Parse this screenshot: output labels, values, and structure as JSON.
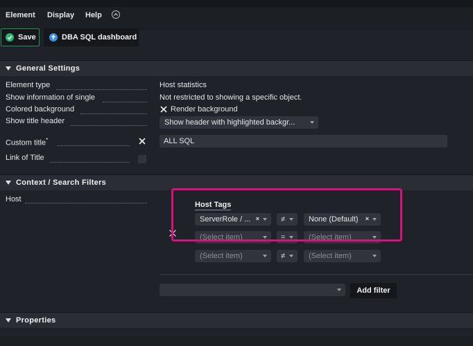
{
  "menu": {
    "items": [
      "Element",
      "Display",
      "Help"
    ]
  },
  "toolbar": {
    "save_label": "Save",
    "dashboard_label": "DBA SQL dashboard"
  },
  "general": {
    "title": "General Settings",
    "rows": {
      "element_type": {
        "label": "Element type",
        "value": "Host statistics"
      },
      "show_info": {
        "label": "Show information of single",
        "value": "Not restricted to showing a specific object."
      },
      "colored_bg": {
        "label": "Colored background",
        "value": "Render background"
      },
      "title_header": {
        "label": "Show title header",
        "value": "Show header with highlighted backgr..."
      },
      "custom_title": {
        "label": "Custom title",
        "required_mark": "*",
        "value": "ALL SQL"
      },
      "link_title": {
        "label": "Link of Title"
      }
    }
  },
  "context": {
    "title": "Context / Search Filters",
    "host_label": "Host",
    "host_tags_title": "Host Tags",
    "tag_rows": [
      {
        "left": "ServerRole / ...",
        "left_clear": "×",
        "op": "≠",
        "right": "None (Default)",
        "right_clear": "×"
      },
      {
        "left": "(Select item)",
        "op": "=",
        "right": "(Select item)"
      },
      {
        "left": "(Select item)",
        "op": "≠",
        "right": "(Select item)"
      }
    ],
    "add_filter_label": "Add filter"
  },
  "properties": {
    "title": "Properties"
  },
  "colors": {
    "accent_green": "#2c8c5a",
    "highlight": "#d4137f",
    "dashboard_icon": "#3d8fe0"
  }
}
